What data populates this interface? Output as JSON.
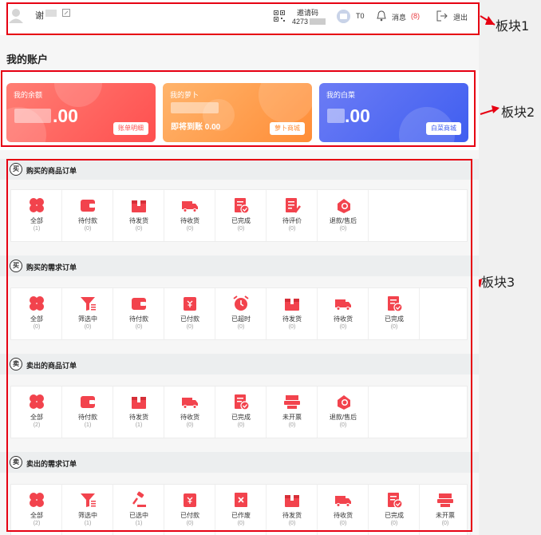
{
  "header": {
    "username": "谢",
    "invite_label": "邀请码",
    "invite_code": "4273",
    "level": "T0",
    "message_label": "消息",
    "message_count": "(8)",
    "logout_label": "退出"
  },
  "account": {
    "title": "我的账户",
    "cards": [
      {
        "title": "我的余额",
        "value": ".00",
        "sub": "",
        "button": "账单明细",
        "gradient_from": "#ff7e74",
        "gradient_to": "#ff4f4f"
      },
      {
        "title": "我的萝卜",
        "value": "",
        "sub": "即将到账 0.00",
        "button": "萝卜商城",
        "gradient_from": "#ffb46c",
        "gradient_to": "#ff8d37"
      },
      {
        "title": "我的白菜",
        "value": ".00",
        "sub": "",
        "button": "白菜商城",
        "gradient_from": "#6c7cf5",
        "gradient_to": "#3f5ef0"
      }
    ]
  },
  "sections": [
    {
      "badge": "买",
      "title": "购买的商品订单",
      "items": [
        {
          "icon": "grid-icon",
          "label": "全部",
          "count": "(1)"
        },
        {
          "icon": "wallet-icon",
          "label": "待付款",
          "count": "(0)"
        },
        {
          "icon": "box-icon",
          "label": "待发货",
          "count": "(0)"
        },
        {
          "icon": "truck-icon",
          "label": "待收货",
          "count": "(0)"
        },
        {
          "icon": "doc-check-icon",
          "label": "已完成",
          "count": "(0)"
        },
        {
          "icon": "doc-edit-icon",
          "label": "待评价",
          "count": "(0)"
        },
        {
          "icon": "refund-icon",
          "label": "退款/售后",
          "count": "(0)"
        }
      ]
    },
    {
      "badge": "买",
      "title": "购买的需求订单",
      "items": [
        {
          "icon": "grid-icon",
          "label": "全部",
          "count": "(0)"
        },
        {
          "icon": "filter-icon",
          "label": "筛选中",
          "count": "(0)"
        },
        {
          "icon": "wallet-icon",
          "label": "待付款",
          "count": "(0)"
        },
        {
          "icon": "paid-icon",
          "label": "已付款",
          "count": "(0)"
        },
        {
          "icon": "alarm-icon",
          "label": "已超时",
          "count": "(0)"
        },
        {
          "icon": "box-icon",
          "label": "待发货",
          "count": "(0)"
        },
        {
          "icon": "truck-icon",
          "label": "待收货",
          "count": "(0)"
        },
        {
          "icon": "doc-check-icon",
          "label": "已完成",
          "count": "(0)"
        }
      ]
    },
    {
      "badge": "卖",
      "title": "卖出的商品订单",
      "items": [
        {
          "icon": "grid-icon",
          "label": "全部",
          "count": "(2)"
        },
        {
          "icon": "wallet-icon",
          "label": "待付款",
          "count": "(1)"
        },
        {
          "icon": "box-icon",
          "label": "待发货",
          "count": "(1)"
        },
        {
          "icon": "truck-icon",
          "label": "待收货",
          "count": "(0)"
        },
        {
          "icon": "doc-check-icon",
          "label": "已完成",
          "count": "(0)"
        },
        {
          "icon": "printer-icon",
          "label": "未开票",
          "count": "(0)"
        },
        {
          "icon": "refund-icon",
          "label": "退款/售后",
          "count": "(0)"
        }
      ]
    },
    {
      "badge": "卖",
      "title": "卖出的需求订单",
      "items": [
        {
          "icon": "grid-icon",
          "label": "全部",
          "count": "(2)"
        },
        {
          "icon": "filter-icon",
          "label": "筛选中",
          "count": "(1)"
        },
        {
          "icon": "gavel-icon",
          "label": "已选中",
          "count": "(1)"
        },
        {
          "icon": "paid-icon",
          "label": "已付款",
          "count": "(0)"
        },
        {
          "icon": "doc-x-icon",
          "label": "已作废",
          "count": "(0)"
        },
        {
          "icon": "box-icon",
          "label": "待发货",
          "count": "(0)"
        },
        {
          "icon": "truck-icon",
          "label": "待收货",
          "count": "(0)"
        },
        {
          "icon": "doc-check-icon",
          "label": "已完成",
          "count": "(0)"
        },
        {
          "icon": "printer-icon",
          "label": "未开票",
          "count": "(0)"
        }
      ]
    }
  ],
  "annotations": {
    "block1": "板块1",
    "block2": "板块2",
    "block3": "板块3"
  },
  "colors": {
    "accent_red": "#f2434d",
    "annotation_red": "#e60012"
  }
}
